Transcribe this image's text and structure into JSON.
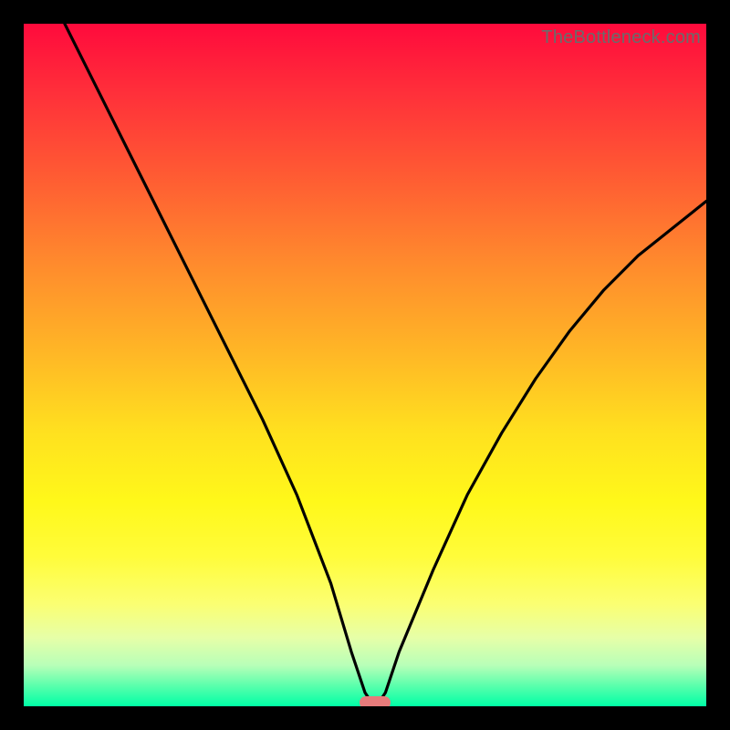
{
  "watermark": "TheBottleneck.com",
  "colors": {
    "frame_bg": "#000000",
    "gradient_top": "#ff0a3c",
    "gradient_bottom": "#00ffa6",
    "curve_stroke": "#000000",
    "marker_fill": "#e77b7b",
    "watermark_text": "#6b6b6b"
  },
  "chart_data": {
    "type": "line",
    "title": "",
    "xlabel": "",
    "ylabel": "",
    "xlim": [
      0,
      100
    ],
    "ylim": [
      0,
      100
    ],
    "grid": false,
    "legend": false,
    "series": [
      {
        "name": "bottleneck-curve",
        "x": [
          6,
          10,
          15,
          20,
          25,
          30,
          35,
          40,
          45,
          48,
          50,
          51,
          52,
          53,
          55,
          60,
          65,
          70,
          75,
          80,
          85,
          90,
          95,
          100
        ],
        "y": [
          100,
          92,
          82,
          72,
          62,
          52,
          42,
          31,
          18,
          8,
          2,
          0.5,
          0.5,
          2,
          8,
          20,
          31,
          40,
          48,
          55,
          61,
          66,
          70,
          74
        ]
      }
    ],
    "annotations": [
      {
        "name": "optimal-marker",
        "x": 51.5,
        "y": 0.5,
        "shape": "pill",
        "color": "#e77b7b"
      }
    ],
    "background": "vertical-gradient red→yellow→green (high=bad, low=good)"
  }
}
